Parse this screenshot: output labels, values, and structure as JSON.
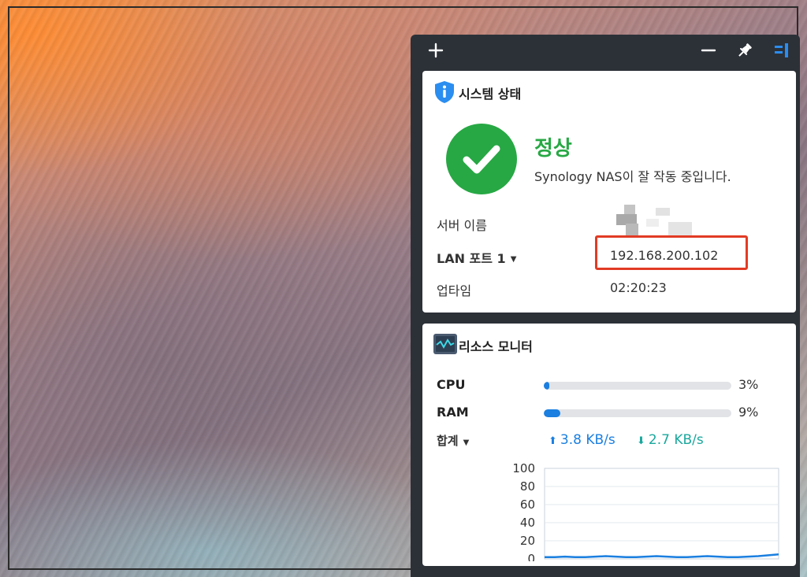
{
  "panel_toolbar": {
    "add_icon": "plus-icon",
    "minimize_icon": "minus-icon",
    "pin_icon": "pin-icon",
    "sidebar_icon": "sidebar-toggle-icon"
  },
  "system_status": {
    "title": "시스템 상태",
    "icon": "info-shield-icon",
    "status": "정상",
    "status_color": "#27a844",
    "description": "Synology NAS이 잘 작동 중입니다.",
    "server_name_label": "서버 이름",
    "server_name_value": "",
    "lan_label": "LAN 포트 1",
    "lan_value": "192.168.200.102",
    "uptime_label": "업타임",
    "uptime_value": "02:20:23",
    "highlight_color": "#e23b24"
  },
  "resource_monitor": {
    "title": "리소스 모니터",
    "icon": "monitor-wave-icon",
    "cpu_label": "CPU",
    "cpu_percent_text": "3%",
    "cpu_fraction": 0.03,
    "ram_label": "RAM",
    "ram_percent_text": "9%",
    "ram_fraction": 0.09,
    "network_label": "합계",
    "upload": "3.8 KB/s",
    "download": "2.7 KB/s",
    "upload_color": "#1a7fe0",
    "download_color": "#1aa89e"
  },
  "chart_data": {
    "type": "line",
    "title": "",
    "xlabel": "",
    "ylabel": "",
    "ylim": [
      0,
      100
    ],
    "yticks": [
      "100",
      "80",
      "60",
      "40",
      "20",
      "0"
    ],
    "grid": true,
    "series": [
      {
        "values": [
          2,
          2,
          2.5,
          2,
          2,
          2.5,
          3,
          2.5,
          2,
          2,
          2.5,
          3,
          2.5,
          2,
          2,
          2.5,
          3,
          2.5,
          2,
          2,
          2.5,
          3,
          4,
          5
        ]
      }
    ]
  }
}
